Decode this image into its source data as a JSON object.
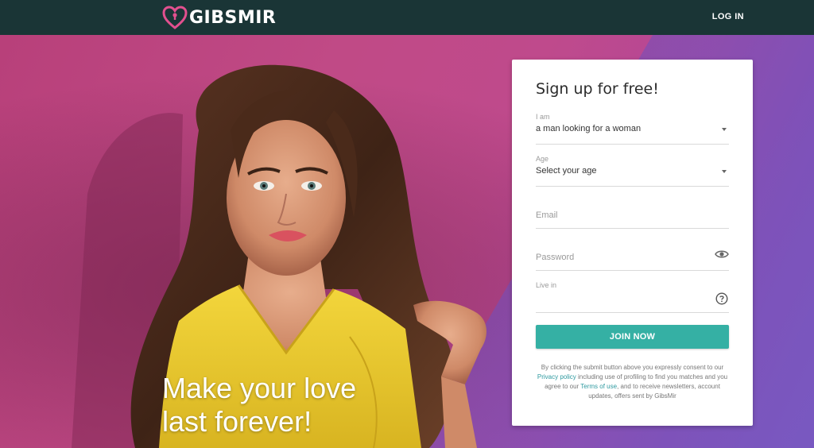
{
  "header": {
    "logo_text": "GIBSMIR",
    "login_label": "LOG IN"
  },
  "hero": {
    "tagline_line1": "Make your love",
    "tagline_line2": "last forever!"
  },
  "signup": {
    "title": "Sign up for free!",
    "iam": {
      "label": "I am",
      "value": "a man looking for a woman"
    },
    "age": {
      "label": "Age",
      "value": "Select your age"
    },
    "email": {
      "placeholder": "Email"
    },
    "password": {
      "placeholder": "Password"
    },
    "live_in": {
      "label": "Live in"
    },
    "join_label": "JOIN NOW",
    "legal": {
      "part1": "By clicking the submit button above you expressly consent to our ",
      "privacy_link": "Privacy policy",
      "part2": " including use of profiling to find you matches and you agree to our ",
      "terms_link": "Terms of use",
      "part3": ", and to receive newsletters, account updates, offers sent by GibsMir"
    }
  },
  "colors": {
    "topbar": "#1a3536",
    "accent": "#35b0a4",
    "logo_heart": "#e2508f",
    "link": "#2f9aa0"
  },
  "icons": {
    "logo": "heart-lock-icon",
    "age_caret": "chevron-down-icon",
    "password_toggle": "eye-icon",
    "live_in_help": "help-circle-icon"
  }
}
